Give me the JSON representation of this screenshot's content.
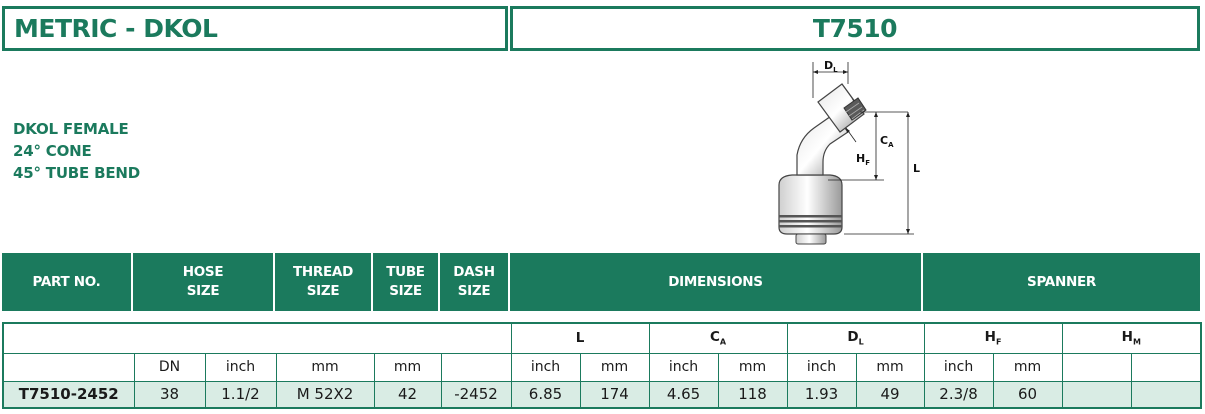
{
  "header": {
    "series": "METRIC - DKOL",
    "part_family": "T7510"
  },
  "description": [
    "DKOL FEMALE",
    "24° CONE",
    "45° TUBE BEND"
  ],
  "drawing": {
    "labels": {
      "dl": "D",
      "dl_sub": "L",
      "ca": "C",
      "ca_sub": "A",
      "hf": "H",
      "hf_sub": "F",
      "l": "L"
    }
  },
  "group_headers": {
    "part_no": "PART NO.",
    "hose_size": [
      "HOSE",
      "SIZE"
    ],
    "thread_size": [
      "THREAD",
      "SIZE"
    ],
    "tube_size": [
      "TUBE",
      "SIZE"
    ],
    "dash_size": [
      "DASH",
      "SIZE"
    ],
    "dimensions": "DIMENSIONS",
    "spanner": "SPANNER"
  },
  "dim_headers": {
    "l": "L",
    "ca": "C",
    "ca_sub": "A",
    "dl": "D",
    "dl_sub": "L",
    "hf": "H",
    "hf_sub": "F",
    "hm": "H",
    "hm_sub": "M"
  },
  "units": [
    "",
    "DN",
    "inch",
    "mm",
    "mm",
    "",
    "inch",
    "mm",
    "inch",
    "mm",
    "inch",
    "mm",
    "inch",
    "mm",
    "",
    ""
  ],
  "rows": [
    [
      "T7510-2452",
      "38",
      "1.1/2",
      "M 52X2",
      "42",
      "-2452",
      "6.85",
      "174",
      "4.65",
      "118",
      "1.93",
      "49",
      "2.3/8",
      "60",
      "",
      ""
    ]
  ],
  "colors": {
    "brand_green": "#1b7a5d",
    "row_fill": "#d9ece4"
  }
}
